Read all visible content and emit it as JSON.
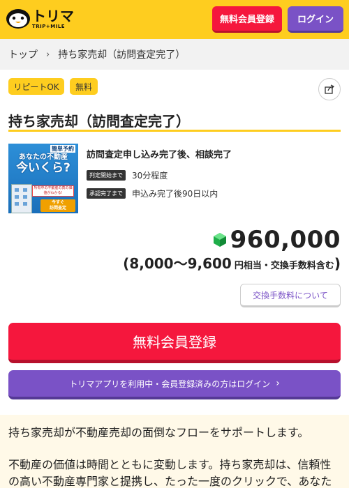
{
  "header": {
    "logo_name": "トリマ",
    "logo_sub": "TRIP+MILE",
    "register_label": "無料会員登録",
    "login_label": "ログイン",
    "brand_color": "#fecd1f"
  },
  "breadcrumb": {
    "items": [
      "トップ",
      "持ち家売却（訪問査定完了）"
    ]
  },
  "tags": [
    "リピートOK",
    "無料"
  ],
  "offer": {
    "title": "持ち家売却（訪問査定完了）",
    "headline": "訪問査定申し込み完了後、相談完了",
    "times": [
      {
        "label": "判定開始まで",
        "value": "30分程度"
      },
      {
        "label": "承認完了まで",
        "value": "申込み完了後90日以内"
      }
    ],
    "thumbnail": {
      "top_text": "簡単予約",
      "main_line1": "あなたの不動産",
      "main_line2": "今いくら?",
      "card_text": "所有中の不動産の真の価値がわかる!",
      "cta_line1": "今すぐ",
      "cta_line2": "訪問査定"
    },
    "points": "960,000",
    "range_open": "(",
    "range_low": "8,000",
    "range_sep": " 〜 ",
    "range_high": "9,600",
    "range_unit": "円相当・交換手数料含む",
    "range_close": ")",
    "fee_link": "交換手数料について"
  },
  "actions": {
    "register_label": "無料会員登録",
    "login_label": "トリマアプリを利用中・会員登録済みの方はログイン",
    "register_color": "#f5173d",
    "login_color": "#7a52c6"
  },
  "description": {
    "paragraphs": [
      "持ち家売却が不動産売却の面倒なフローをサポートします。",
      "不動産の価値は時間とともに変動します。持ち家売却は、信頼性の高い不動産専門家と提携し、たった一度のクリックで、あなた"
    ]
  }
}
